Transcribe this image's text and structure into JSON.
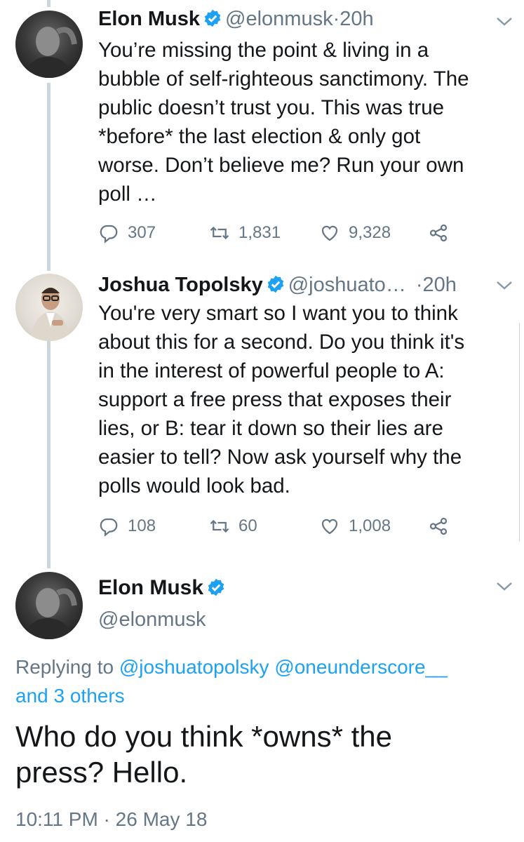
{
  "tweets": [
    {
      "name": "Elon Musk",
      "handle": "@elonmusk",
      "separator": "·",
      "time": "20h",
      "text": "You’re missing the point & living in a\nbubble of self-righteous sanctimony. The\npublic doesn’t trust you. This was true\n*before* the last election & only got\nworse. Don’t believe me? Run your own\npoll …",
      "replies": "307",
      "retweets": "1,831",
      "likes": "9,328"
    },
    {
      "name": "Joshua Topolsky",
      "handle": "@joshuato…",
      "separator": "·",
      "time": "20h",
      "text": "You're very smart so I want you to think\nabout this for a second. Do you think it's\nin the interest of powerful people to A:\nsupport a free press that exposes their\nlies, or B: tear it down so their lies are\neasier to tell? Now ask yourself why the\npolls would look bad.",
      "replies": "108",
      "retweets": "60",
      "likes": "1,008"
    }
  ],
  "main_tweet": {
    "name": "Elon Musk",
    "handle": "@elonmusk",
    "replying_prefix": "Replying to",
    "reply_user_1": "@joshuatopolsky",
    "reply_user_2": "@oneunderscore__",
    "reply_others": "and 3 others",
    "text": "Who do you think *owns* the\npress? Hello.",
    "timestamp": "10:11 PM · 26 May 18"
  },
  "icons": {
    "reply": "reply-icon",
    "retweet": "retweet-icon",
    "like": "heart-icon",
    "share": "share-icon",
    "verified": "verified-badge-icon",
    "more": "chevron-down-icon"
  },
  "colors": {
    "accent": "#1da1f2",
    "muted": "#657786",
    "text": "#14171a",
    "thread": "#ccd6dd"
  }
}
